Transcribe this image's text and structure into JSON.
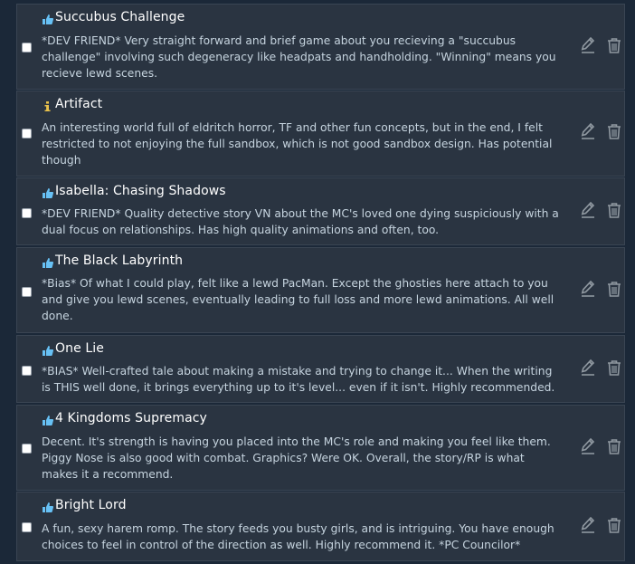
{
  "colors": {
    "page_background": "#1b2838",
    "card_background": "#2a3441",
    "title": "#ffffff",
    "description": "#c6d4df",
    "tag_icon": "#67c1f5",
    "info_icon": "#e8c14b",
    "action_icon": "#8f98a0"
  },
  "reviews": [
    {
      "icon": "thumbs-up-icon",
      "title": "Succubus Challenge",
      "description": "*DEV FRIEND* Very straight forward and brief game about you recieving a \"succubus challenge\" involving such degeneracy like headpats and handholding. \"Winning\" means you recieve lewd scenes."
    },
    {
      "icon": "info-icon",
      "title": "Artifact",
      "description": "An interesting world full of eldritch horror, TF and other fun concepts, but in the end, I felt restricted to not enjoying the full sandbox, which is not good sandbox design. Has potential though"
    },
    {
      "icon": "thumbs-up-icon",
      "title": "Isabella: Chasing Shadows",
      "description": "*DEV FRIEND* Quality detective story VN about the MC's loved one dying suspiciously with a dual focus on relationships. Has high quality animations and often, too."
    },
    {
      "icon": "thumbs-up-icon",
      "title": "The Black Labyrinth",
      "description": "*Bias* Of what I could play, felt like a lewd PacMan. Except the ghosties here attach to you and give you lewd scenes, eventually leading to full loss and more lewd animations. All well done."
    },
    {
      "icon": "thumbs-up-icon",
      "title": "One Lie",
      "description": "*BIAS* Well-crafted tale about making a mistake and trying to change it... When the writing is THIS well done, it brings everything up to it's level... even if it isn't. Highly recommended."
    },
    {
      "icon": "thumbs-up-icon",
      "title": "4 Kingdoms Supremacy",
      "description": "Decent. It's strength is having you placed into the MC's role and making you feel like them. Piggy Nose is also good with combat. Graphics? Were OK. Overall, the story/RP is what makes it a recommend."
    },
    {
      "icon": "thumbs-up-icon",
      "title": "Bright Lord",
      "description": "A fun, sexy harem romp. The story feeds you busty girls, and is intriguing. You have enough choices to feel in control of the direction as well. Highly recommend it. *PC Councilor*"
    }
  ]
}
